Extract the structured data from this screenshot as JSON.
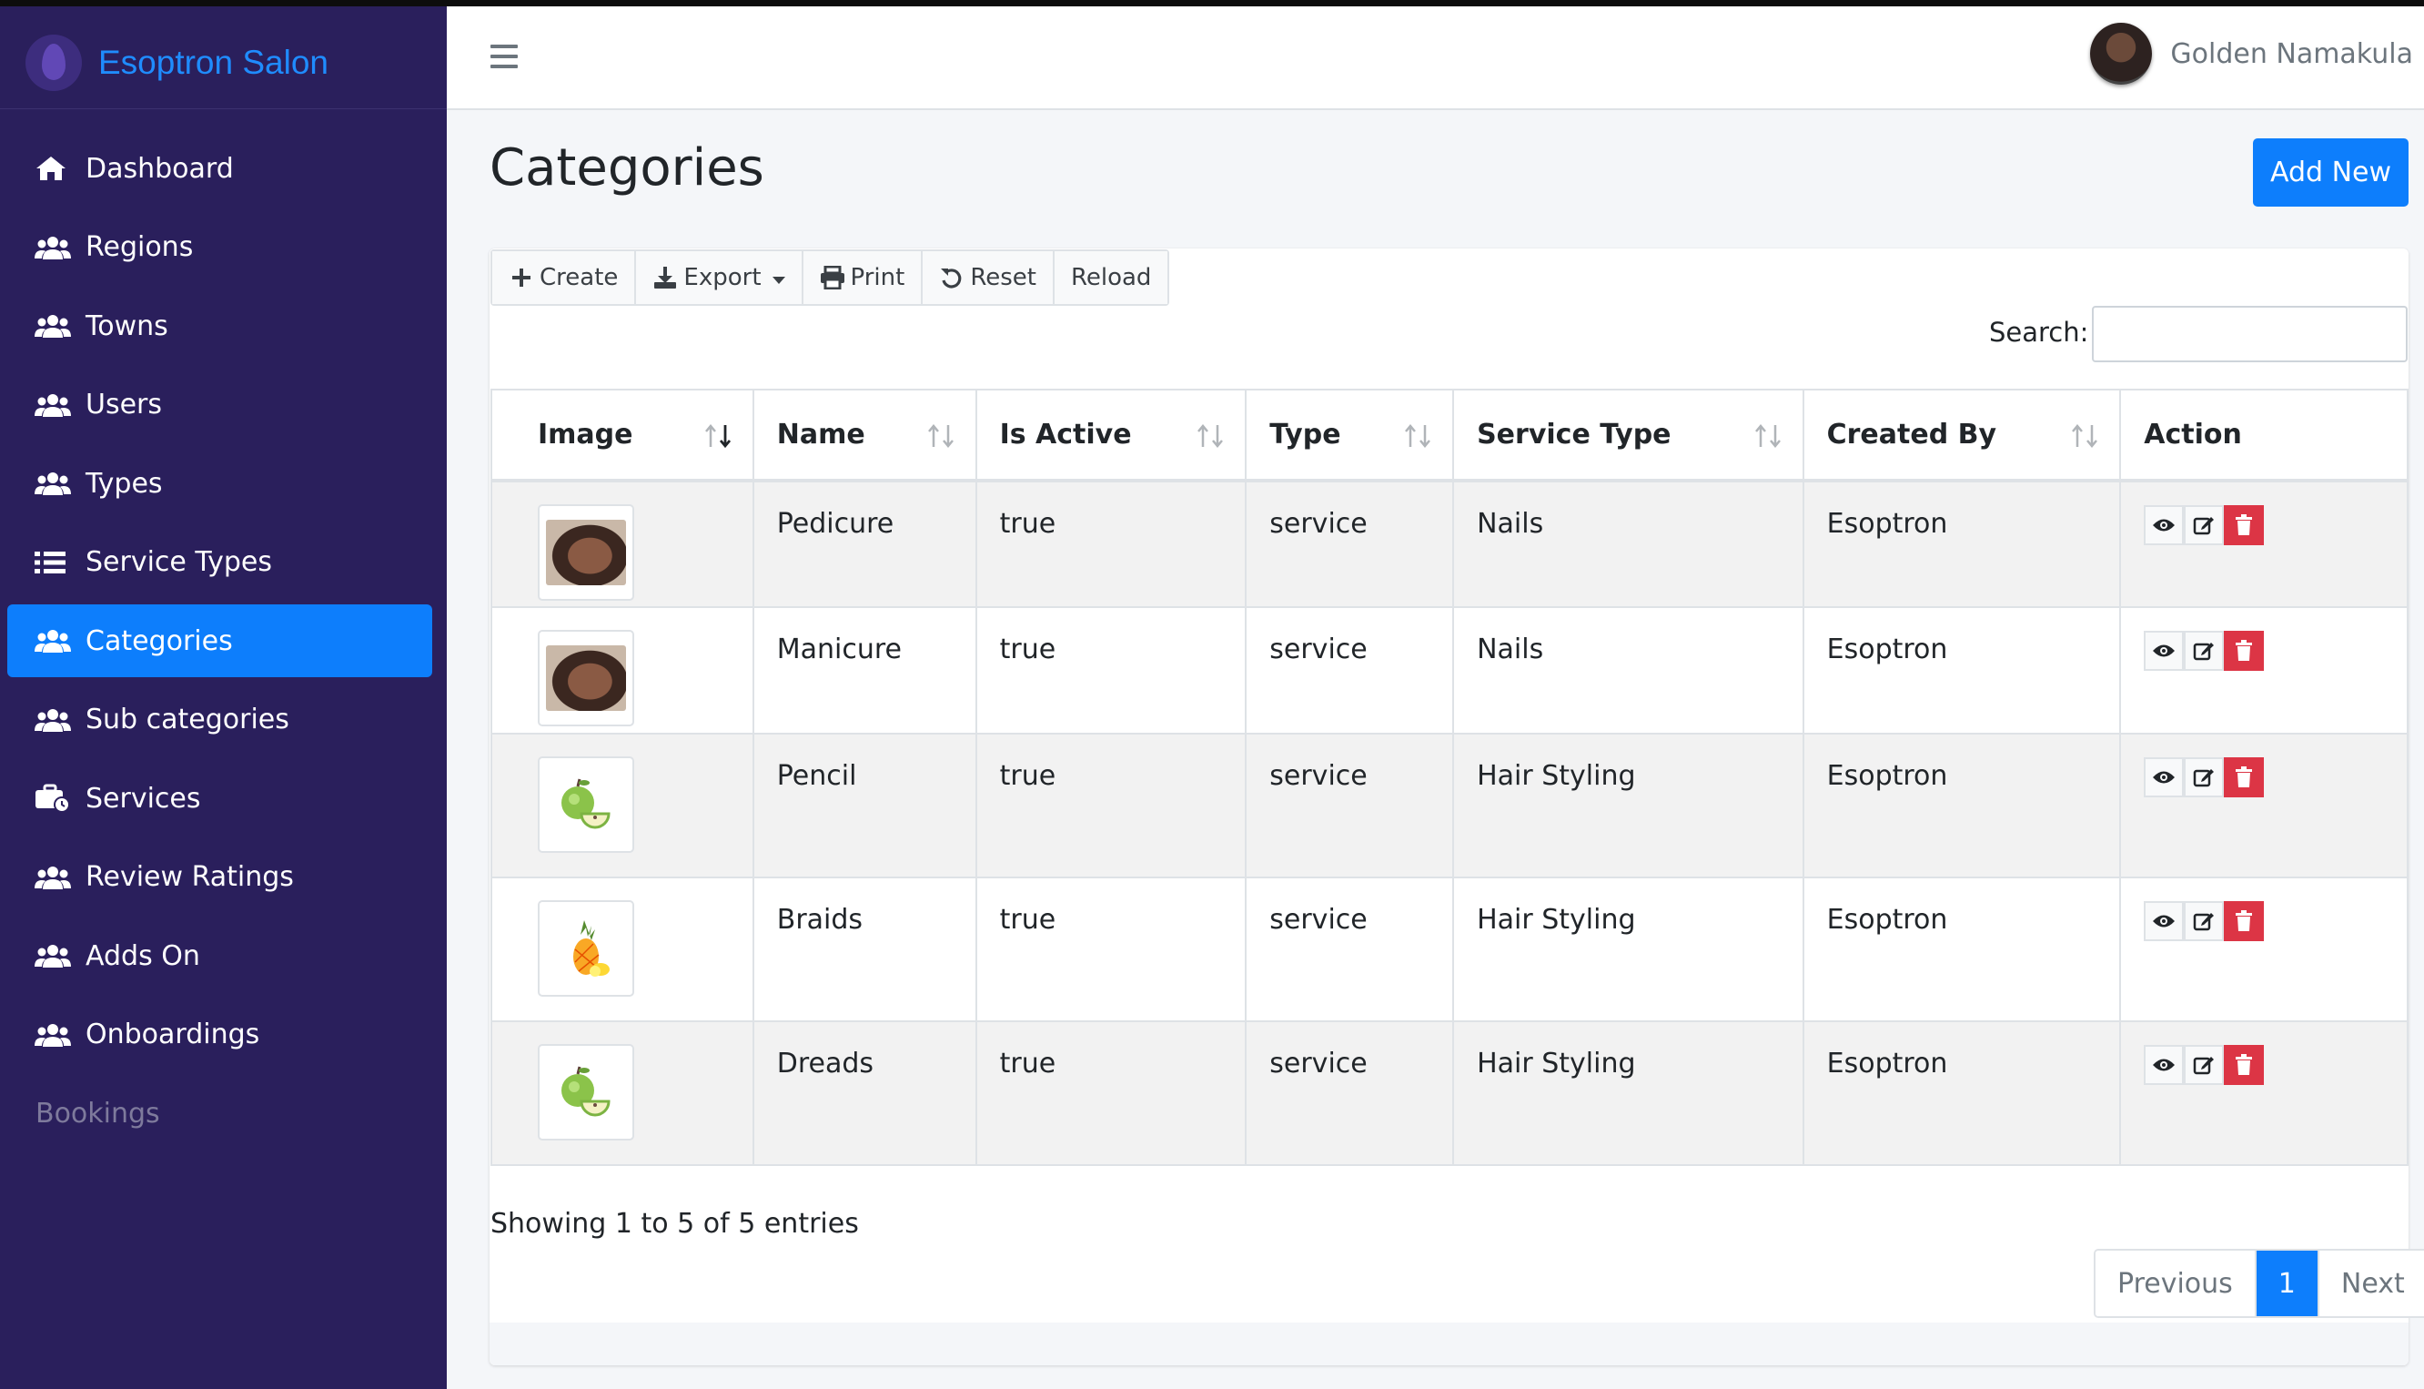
{
  "app": {
    "brand": "Esoptron Salon"
  },
  "sidebar": {
    "items": [
      {
        "label": "Dashboard",
        "icon": "home-icon"
      },
      {
        "label": "Regions",
        "icon": "users-icon"
      },
      {
        "label": "Towns",
        "icon": "users-icon"
      },
      {
        "label": "Users",
        "icon": "users-icon"
      },
      {
        "label": "Types",
        "icon": "users-icon"
      },
      {
        "label": "Service Types",
        "icon": "list-icon"
      },
      {
        "label": "Categories",
        "icon": "users-icon",
        "active": true
      },
      {
        "label": "Sub categories",
        "icon": "users-icon"
      },
      {
        "label": "Services",
        "icon": "briefcase-clock-icon"
      },
      {
        "label": "Review Ratings",
        "icon": "users-icon"
      },
      {
        "label": "Adds On",
        "icon": "users-icon"
      },
      {
        "label": "Onboardings",
        "icon": "users-icon"
      }
    ],
    "section_header": "Bookings"
  },
  "topbar": {
    "user_name": "Golden Namakula"
  },
  "page": {
    "title": "Categories",
    "add_new": "Add New"
  },
  "toolbar": {
    "create": "Create",
    "export": "Export",
    "print": "Print",
    "reset": "Reset",
    "reload": "Reload"
  },
  "search": {
    "label": "Search:",
    "value": ""
  },
  "table": {
    "columns": [
      "Image",
      "Name",
      "Is Active",
      "Type",
      "Service Type",
      "Created By",
      "Action"
    ],
    "rows": [
      {
        "image": "face-photo",
        "name": "Pedicure",
        "is_active": "true",
        "type": "service",
        "service_type": "Nails",
        "created_by": "Esoptron"
      },
      {
        "image": "face-photo",
        "name": "Manicure",
        "is_active": "true",
        "type": "service",
        "service_type": "Nails",
        "created_by": "Esoptron"
      },
      {
        "image": "green-apples",
        "name": "Pencil",
        "is_active": "true",
        "type": "service",
        "service_type": "Hair Styling",
        "created_by": "Esoptron"
      },
      {
        "image": "pineapple",
        "name": "Braids",
        "is_active": "true",
        "type": "service",
        "service_type": "Hair Styling",
        "created_by": "Esoptron"
      },
      {
        "image": "green-apples",
        "name": "Dreads",
        "is_active": "true",
        "type": "service",
        "service_type": "Hair Styling",
        "created_by": "Esoptron"
      }
    ]
  },
  "footer": {
    "info": "Showing 1 to 5 of 5 entries",
    "previous": "Previous",
    "page": "1",
    "next": "Next"
  },
  "colors": {
    "sidebar_bg": "#2a1f5c",
    "accent": "#0d7efc",
    "danger": "#dc3545"
  }
}
